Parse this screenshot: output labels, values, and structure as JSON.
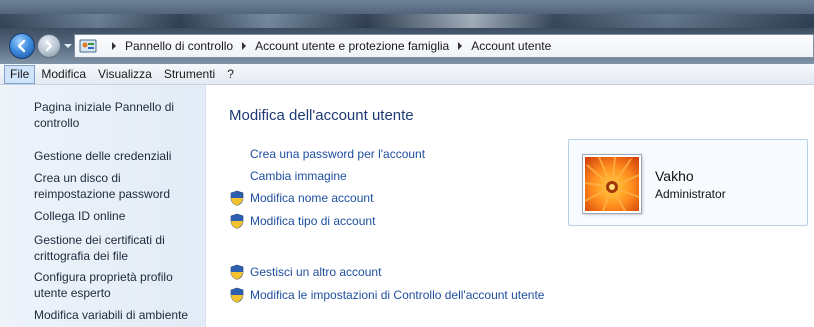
{
  "address_bar": {
    "crumbs": [
      "Pannello di controllo",
      "Account utente e protezione famiglia",
      "Account utente"
    ]
  },
  "menu": {
    "items": [
      "File",
      "Modifica",
      "Visualizza",
      "Strumenti",
      "?"
    ]
  },
  "sidebar": {
    "links": [
      "Pagina iniziale Pannello di controllo",
      "Gestione delle credenziali",
      "Crea un disco di reimpostazione password",
      "Collega ID online",
      "Gestione dei certificati di crittografia dei file",
      "Configura proprietà profilo utente esperto",
      "Modifica variabili di ambiente"
    ]
  },
  "main": {
    "title": "Modifica dell'account utente",
    "tasks": [
      "Crea una password per l'account",
      "Cambia immagine",
      "Modifica nome account",
      "Modifica tipo di account",
      "Gestisci un altro account",
      "Modifica le impostazioni di Controllo dell'account utente"
    ]
  },
  "account": {
    "name": "Vakho",
    "role": "Administrator"
  },
  "colors": {
    "link": "#1f4fa0",
    "title": "#1e3a74",
    "highlight": "#ffff3a",
    "sidebar_bg": "#e8eff8"
  },
  "icons": [
    "back-icon",
    "forward-icon",
    "control-panel-icon",
    "chevron-right-icon",
    "uac-shield-icon",
    "flower-avatar"
  ]
}
